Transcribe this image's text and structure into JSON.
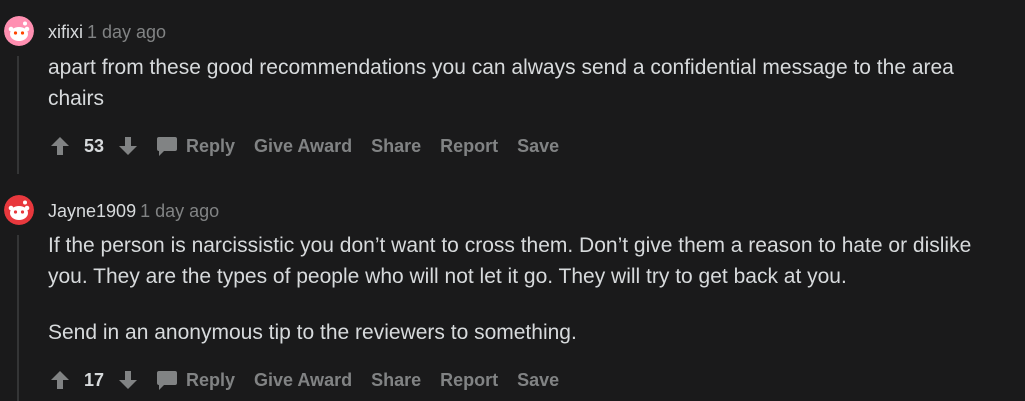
{
  "comments": [
    {
      "author": "xifixi",
      "time": "1 day ago",
      "paragraphs": [
        "apart from these good recommendations you can always send a confidential message to the area chairs"
      ],
      "score": "53",
      "actions": {
        "reply": "Reply",
        "give_award": "Give Award",
        "share": "Share",
        "report": "Report",
        "save": "Save"
      },
      "avatar_color": "#ff585b"
    },
    {
      "author": "Jayne1909",
      "time": "1 day ago",
      "paragraphs": [
        "If the person is narcissistic you don’t want to cross them. Don’t give them a reason to hate or dislike you. They are the types of people who will not let it go. They will try to get back at you.",
        "Send in an anonymous tip to the reviewers to something."
      ],
      "score": "17",
      "actions": {
        "reply": "Reply",
        "give_award": "Give Award",
        "share": "Share",
        "report": "Report",
        "save": "Save"
      },
      "avatar_color": "#e8383d"
    }
  ],
  "icons": {
    "upvote": "upvote-arrow-icon",
    "downvote": "downvote-arrow-icon",
    "reply": "speech-bubble-icon",
    "avatar": "snoo-avatar-icon"
  },
  "colors": {
    "background": "#1a1a1b",
    "text": "#d7dadc",
    "muted": "#818384",
    "thread_line": "#343536"
  }
}
